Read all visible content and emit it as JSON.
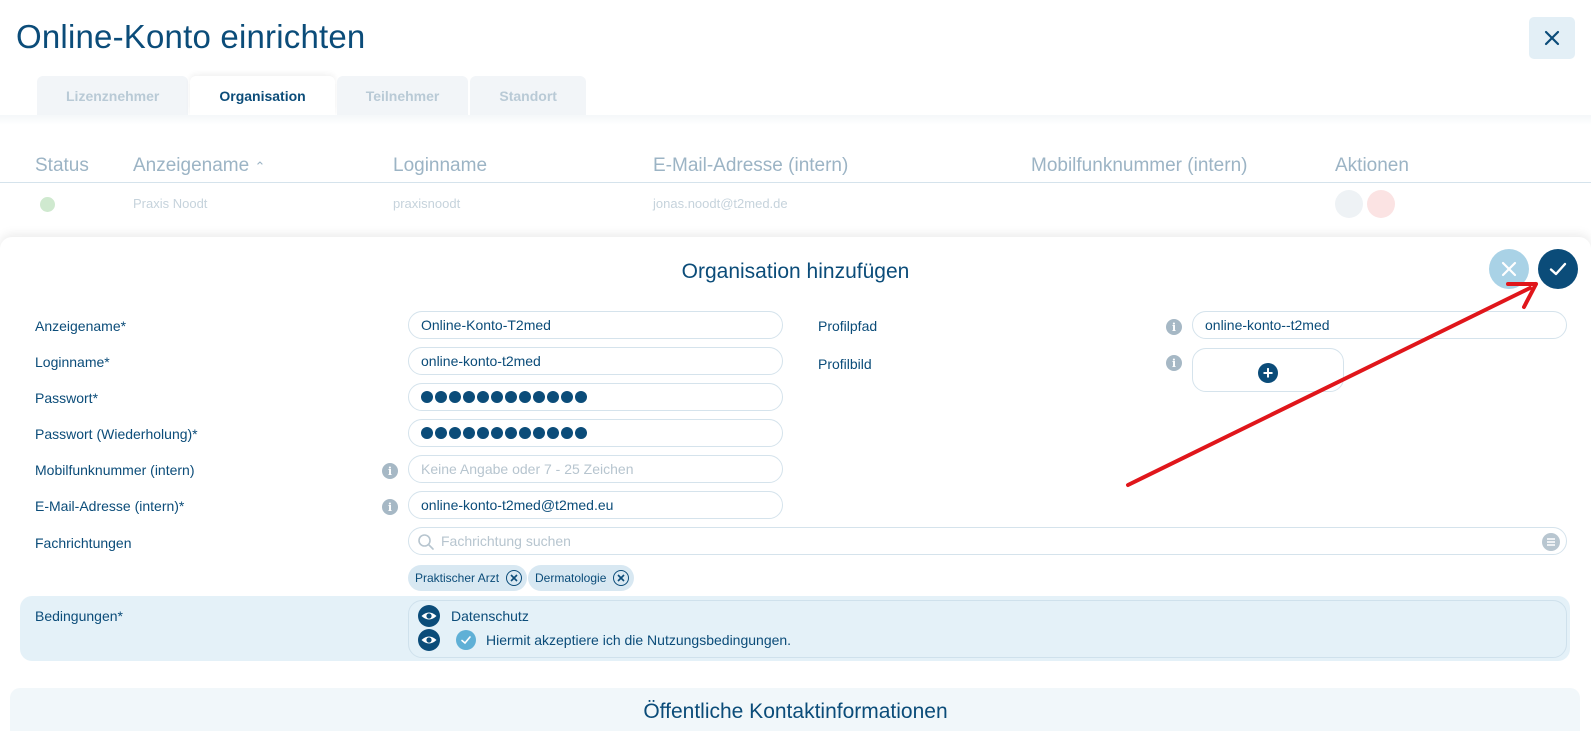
{
  "header": {
    "title": "Online-Konto einrichten"
  },
  "tabs": [
    {
      "label": "Lizenznehmer",
      "active": false
    },
    {
      "label": "Organisation",
      "active": true
    },
    {
      "label": "Teilnehmer",
      "active": false
    },
    {
      "label": "Standort",
      "active": false
    }
  ],
  "table": {
    "columns": [
      "Status",
      "Anzeigename",
      "Loginname",
      "E-Mail-Adresse (intern)",
      "Mobilfunknummer (intern)",
      "Aktionen"
    ],
    "rows": [
      {
        "anzeigename": "Praxis Noodt",
        "loginname": "praxisnoodt",
        "email": "jonas.noodt@t2med.de",
        "mobil": ""
      }
    ]
  },
  "dialog": {
    "title": "Organisation hinzufügen",
    "fields": {
      "anzeigename": {
        "label": "Anzeigename*",
        "value": "Online-Konto-T2med"
      },
      "loginname": {
        "label": "Loginname*",
        "value": "online-konto-t2med"
      },
      "passwort": {
        "label": "Passwort*",
        "masked_length": 12
      },
      "passwort_wdh": {
        "label": "Passwort (Wiederholung)*",
        "masked_length": 12
      },
      "mobil": {
        "label": "Mobilfunknummer (intern)",
        "value": "",
        "placeholder": "Keine Angabe oder 7 - 25 Zeichen"
      },
      "email": {
        "label": "E-Mail-Adresse (intern)*",
        "value": "online-konto-t2med@t2med.eu"
      },
      "profilpfad": {
        "label": "Profilpfad",
        "value": "online-konto--t2med"
      },
      "profilbild": {
        "label": "Profilbild"
      },
      "fachrichtungen": {
        "label": "Fachrichtungen",
        "placeholder": "Fachrichtung suchen",
        "chips": [
          "Praktischer Arzt",
          "Dermatologie"
        ]
      },
      "bedingungen": {
        "label": "Bedingungen*",
        "items": [
          "Datenschutz",
          "Hiermit akzeptiere ich die Nutzungsbedingungen."
        ],
        "accepted": true
      }
    }
  },
  "contact": {
    "title": "Öffentliche Kontaktinformationen"
  },
  "colors": {
    "primary": "#0b4c79",
    "accent_light": "#a9d2e6",
    "condition_bg": "#e4f1f8",
    "annotation_arrow": "#e0161b"
  }
}
